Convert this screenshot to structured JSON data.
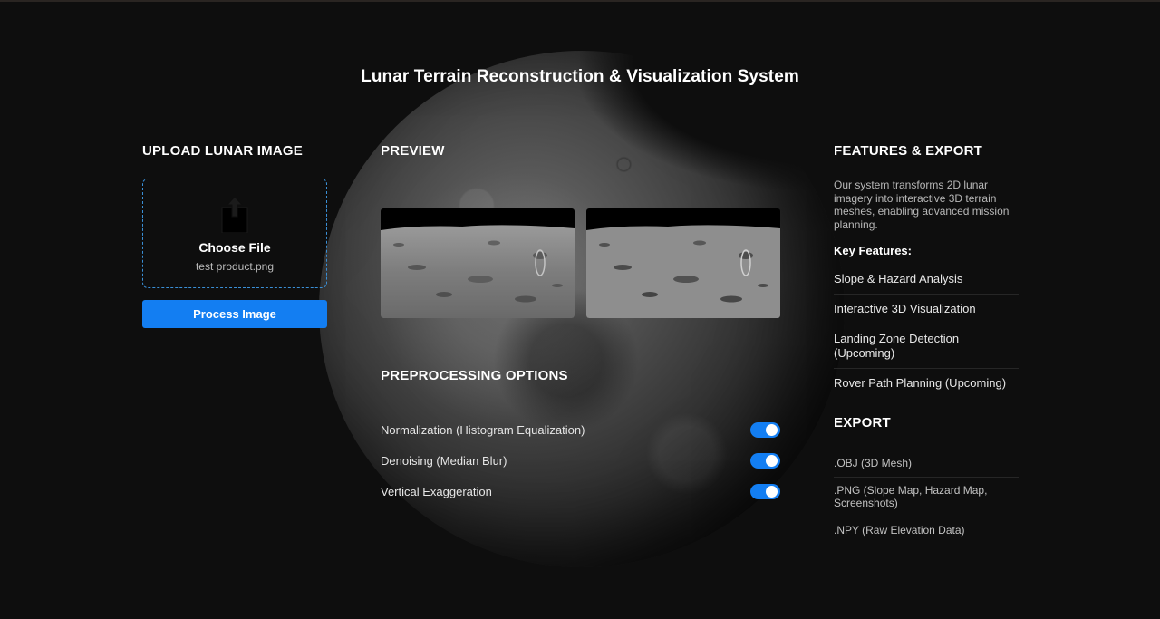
{
  "page": {
    "title": "Lunar Terrain Reconstruction & Visualization System"
  },
  "upload": {
    "heading": "UPLOAD LUNAR IMAGE",
    "choose_label": "Choose File",
    "file_name": "test product.png",
    "process_button": "Process Image",
    "icon": "upload-icon"
  },
  "preview": {
    "heading": "PREVIEW"
  },
  "preprocessing": {
    "heading": "PREPROCESSING OPTIONS",
    "options": [
      {
        "label": "Normalization (Histogram Equalization)",
        "enabled": true
      },
      {
        "label": "Denoising (Median Blur)",
        "enabled": true
      },
      {
        "label": "Vertical Exaggeration",
        "enabled": true
      }
    ]
  },
  "features": {
    "heading": "FEATURES & EXPORT",
    "description": "Our system transforms 2D lunar imagery into interactive 3D terrain meshes, enabling advanced mission planning.",
    "key_features_label": "Key Features:",
    "items": [
      "Slope & Hazard Analysis",
      "Interactive 3D Visualization",
      "Landing Zone Detection (Upcoming)",
      "Rover Path Planning (Upcoming)"
    ]
  },
  "export": {
    "heading": "EXPORT",
    "items": [
      ".OBJ (3D Mesh)",
      ".PNG (Slope Map, Hazard Map, Screenshots)",
      ".NPY (Raw Elevation Data)"
    ]
  },
  "colors": {
    "background": "#0e0e0e",
    "accent": "#137ef2",
    "dropzone_border": "#3a8fd6"
  }
}
